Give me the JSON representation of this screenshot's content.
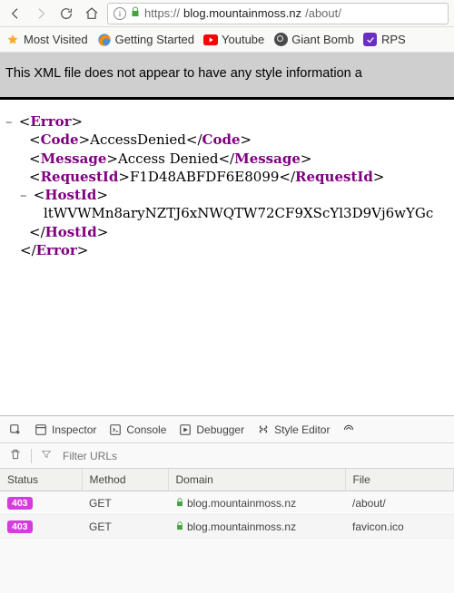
{
  "toolbar": {
    "url_proto": "https://",
    "url_host": "blog.mountainmoss.nz",
    "url_path": "/about/"
  },
  "bookmarks": [
    {
      "label": "Most Visited",
      "icon": "star-icon"
    },
    {
      "label": "Getting Started",
      "icon": "firefox-icon"
    },
    {
      "label": "Youtube",
      "icon": "youtube-icon"
    },
    {
      "label": "Giant Bomb",
      "icon": "bomb-icon"
    },
    {
      "label": "RPS",
      "icon": "rps-icon"
    }
  ],
  "banner_text": "This XML file does not appear to have any style information a",
  "xml": {
    "open_error": "Error",
    "code_tag": "Code",
    "code_val": "AccessDenied",
    "msg_tag": "Message",
    "msg_val": "Access Denied",
    "req_tag": "RequestId",
    "req_val": "F1D48ABFDF6E8099",
    "host_tag": "HostId",
    "host_val": "ltWVWMn8aryNZTJ6xNWQTW72CF9XScYl3D9Vj6wYGc",
    "close_error": "Error"
  },
  "devtools": {
    "tabs": [
      "Inspector",
      "Console",
      "Debugger",
      "Style Editor"
    ],
    "filter_placeholder": "Filter URLs",
    "columns": [
      "Status",
      "Method",
      "Domain",
      "File"
    ],
    "rows": [
      {
        "status": "403",
        "method": "GET",
        "domain": "blog.mountainmoss.nz",
        "file": "/about/"
      },
      {
        "status": "403",
        "method": "GET",
        "domain": "blog.mountainmoss.nz",
        "file": "favicon.ico"
      }
    ]
  }
}
